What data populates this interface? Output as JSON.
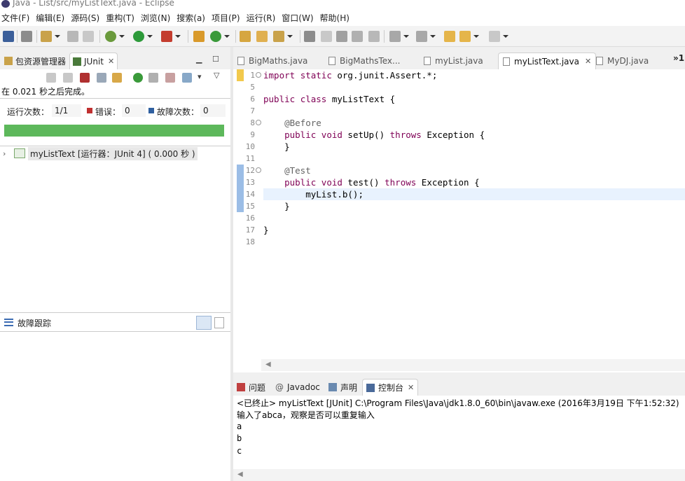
{
  "window": {
    "title": "Java - List/src/myListText.java - Eclipse"
  },
  "menu": [
    "文件(F)",
    "编辑(E)",
    "源码(S)",
    "重构(T)",
    "浏览(N)",
    "搜索(a)",
    "项目(P)",
    "运行(R)",
    "窗口(W)",
    "帮助(H)"
  ],
  "left_tabs": {
    "package_explorer": "包资源管理器",
    "junit": "JUnit"
  },
  "junit": {
    "status": "在 0.021 秒之后完成。",
    "runs_label": "运行次数：",
    "runs_value": "1/1",
    "errors_label": "错误：",
    "errors_value": "0",
    "failures_label": "故障次数：",
    "failures_value": "0",
    "progress_fraction": 1.0,
    "progress_color": "#5db85b",
    "tree_item": "myListText [运行器：JUnit 4] ( 0.000 秒 )",
    "trace_title": "故障跟踪"
  },
  "editor_tabs": [
    {
      "label": "BigMaths.java",
      "active": false
    },
    {
      "label": "BigMathsTex...",
      "active": false
    },
    {
      "label": "myList.java",
      "active": false
    },
    {
      "label": "myListText.java",
      "active": true
    },
    {
      "label": "MyDJ.java",
      "active": false
    }
  ],
  "editor_more": "»1",
  "code_lines": [
    {
      "num": "1",
      "text": "import static org.junit.Assert.*;"
    },
    {
      "num": "5",
      "text": ""
    },
    {
      "num": "6",
      "text": "public class myListText {"
    },
    {
      "num": "7",
      "text": ""
    },
    {
      "num": "8",
      "text": "    @Before"
    },
    {
      "num": "9",
      "text": "    public void setUp() throws Exception {"
    },
    {
      "num": "10",
      "text": "    }"
    },
    {
      "num": "11",
      "text": ""
    },
    {
      "num": "12",
      "text": "    @Test"
    },
    {
      "num": "13",
      "text": "    public void test() throws Exception {"
    },
    {
      "num": "14",
      "text": "        myList.b();"
    },
    {
      "num": "15",
      "text": "    }"
    },
    {
      "num": "16",
      "text": ""
    },
    {
      "num": "17",
      "text": "}"
    },
    {
      "num": "18",
      "text": ""
    }
  ],
  "bottom_tabs": {
    "problems": "问题",
    "javadoc": "Javadoc",
    "declaration": "声明",
    "console": "控制台"
  },
  "console": {
    "header": "<已终止> myListText [JUnit] C:\\Program Files\\Java\\jdk1.8.0_60\\bin\\javaw.exe (2016年3月19日 下午1:52:32)",
    "output": [
      "输入了abca，观察是否可以重复输入",
      "a",
      "b",
      "c"
    ]
  },
  "icons": [
    "eclipse-icon",
    "new-icon",
    "save-icon",
    "debug-icon",
    "run-icon",
    "external-tools-icon",
    "search-icon",
    "back-icon",
    "forward-icon",
    "close-icon",
    "minimize-icon",
    "maximize-icon"
  ]
}
